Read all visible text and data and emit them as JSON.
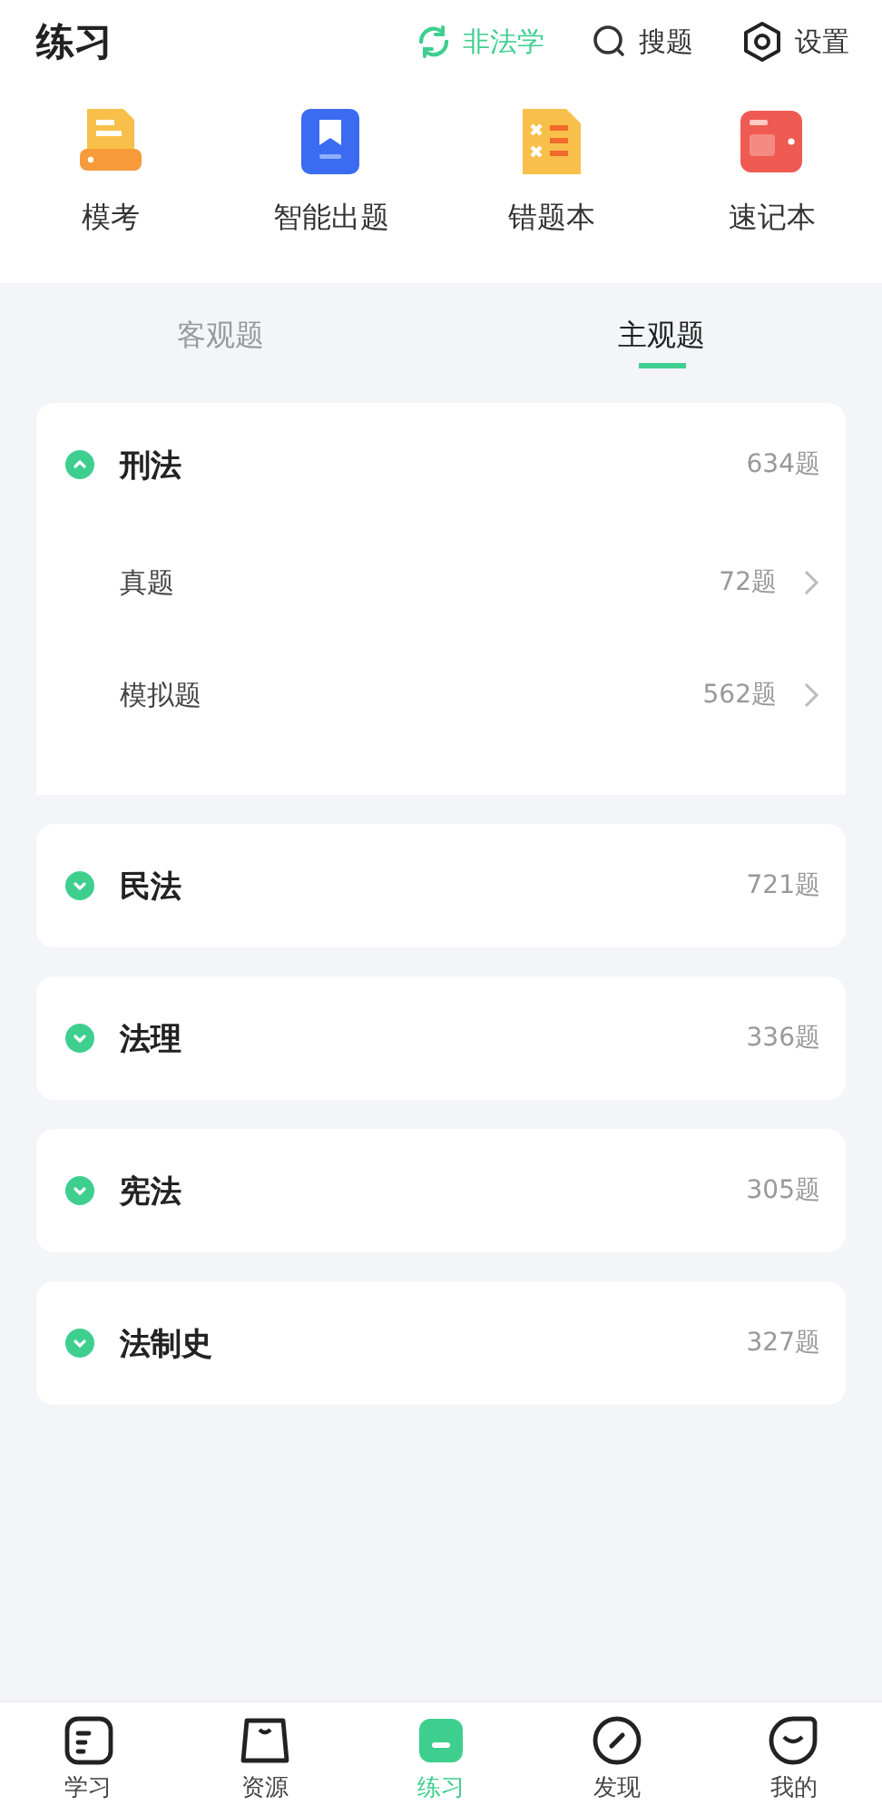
{
  "header": {
    "title": "练习",
    "actions": [
      {
        "kind": "switch",
        "label": "非法学"
      },
      {
        "kind": "search",
        "label": "搜题"
      },
      {
        "kind": "settings",
        "label": "设置"
      }
    ]
  },
  "shortcuts": [
    {
      "kind": "exam",
      "label": "模考"
    },
    {
      "kind": "smart",
      "label": "智能出题"
    },
    {
      "kind": "mistakes",
      "label": "错题本"
    },
    {
      "kind": "notes",
      "label": "速记本"
    }
  ],
  "tabs": [
    {
      "label": "客观题",
      "selected": false
    },
    {
      "label": "主观题",
      "selected": true
    }
  ],
  "subjects": [
    {
      "name": "刑法",
      "count": "634题",
      "expanded": true,
      "children": [
        {
          "name": "真题",
          "count": "72题"
        },
        {
          "name": "模拟题",
          "count": "562题"
        }
      ]
    },
    {
      "name": "民法",
      "count": "721题",
      "expanded": false
    },
    {
      "name": "法理",
      "count": "336题",
      "expanded": false
    },
    {
      "name": "宪法",
      "count": "305题",
      "expanded": false
    },
    {
      "name": "法制史",
      "count": "327题",
      "expanded": false
    }
  ],
  "nav": [
    {
      "kind": "study",
      "label": "学习",
      "selected": false
    },
    {
      "kind": "resources",
      "label": "资源",
      "selected": false
    },
    {
      "kind": "practice",
      "label": "练习",
      "selected": true
    },
    {
      "kind": "discover",
      "label": "发现",
      "selected": false
    },
    {
      "kind": "me",
      "label": "我的",
      "selected": false
    }
  ]
}
